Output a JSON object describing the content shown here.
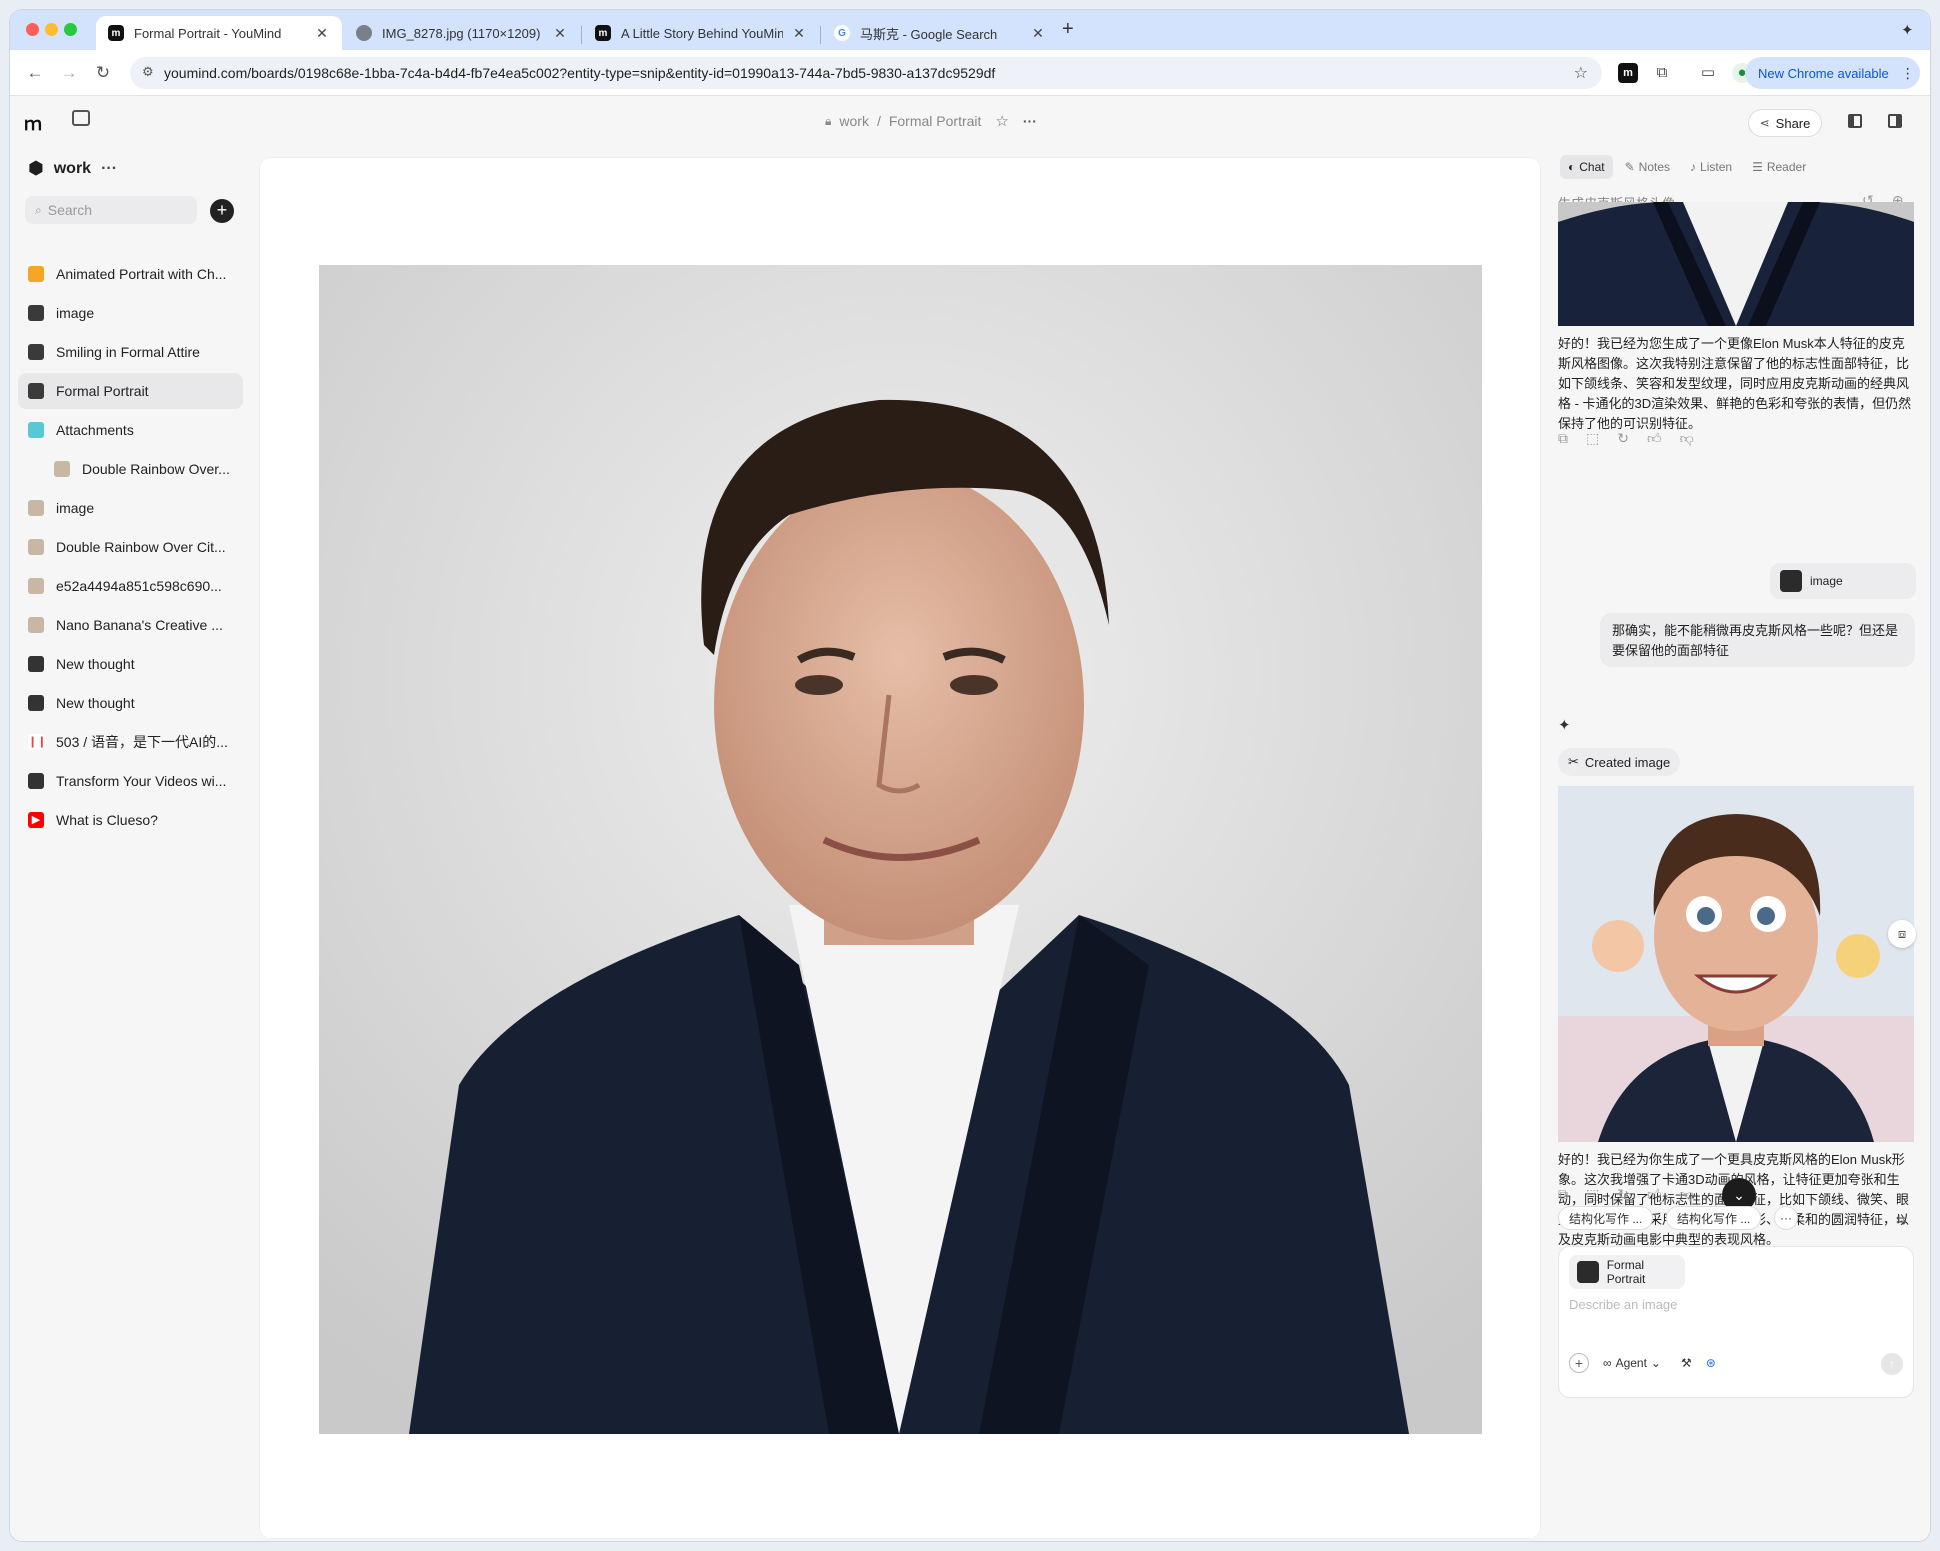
{
  "browser": {
    "tabs": [
      {
        "title": "Formal Portrait - YouMind",
        "active": true
      },
      {
        "title": "IMG_8278.jpg (1170×1209)",
        "active": false
      },
      {
        "title": "A Little Story Behind YouMind",
        "active": false
      },
      {
        "title": "马斯克 - Google Search",
        "active": false
      }
    ],
    "new_tab": "+",
    "url": "youmind.com/boards/0198c68e-1bba-7c4a-b4d4-fb7e4ea5c002?entity-type=snip&entity-id=01990a13-744a-7bd5-9830-a137dc9529df",
    "new_chrome": "New Chrome available"
  },
  "header": {
    "breadcrumb_board": "work",
    "breadcrumb_sep": "/",
    "breadcrumb_page": "Formal Portrait",
    "share": "Share"
  },
  "sidebar": {
    "board_name": "work",
    "board_more": "···",
    "search_placeholder": "Search",
    "items": [
      {
        "label": "Animated Portrait with Ch...",
        "icon": "image-icon"
      },
      {
        "label": "image",
        "icon": "portrait-thumb"
      },
      {
        "label": "Smiling in Formal Attire",
        "icon": "portrait-thumb"
      },
      {
        "label": "Formal Portrait",
        "icon": "portrait-thumb",
        "selected": true
      },
      {
        "label": "Attachments",
        "icon": "folder-icon"
      },
      {
        "label": "Double Rainbow Over...",
        "icon": "image-thumb",
        "indent": true
      },
      {
        "label": "image",
        "icon": "image-thumb"
      },
      {
        "label": "Double Rainbow Over Cit...",
        "icon": "image-thumb"
      },
      {
        "label": "e52a4494a851c598c690...",
        "icon": "image-thumb"
      },
      {
        "label": "Nano Banana's Creative ...",
        "icon": "image-thumb"
      },
      {
        "label": "New thought",
        "icon": "note-icon"
      },
      {
        "label": "New thought",
        "icon": "note-icon"
      },
      {
        "label": "503 / 语音，是下一代AI的...",
        "icon": "audio-icon"
      },
      {
        "label": "Transform Your Videos wi...",
        "icon": "note-icon"
      },
      {
        "label": "What is Clueso?",
        "icon": "youtube-icon"
      }
    ]
  },
  "panel": {
    "tabs": [
      "Chat",
      "Notes",
      "Listen",
      "Reader"
    ],
    "chat_title": "生成皮克斯风格头像",
    "messages": [
      {
        "role": "assistant",
        "text": "好的！我已经为您生成了一个更像Elon Musk本人特征的皮克斯风格图像。这次我特别注意保留了他的标志性面部特征，比如下颌线条、笑容和发型纹理，同时应用皮克斯动画的经典风格 - 卡通化的3D渲染效果、鲜艳的色彩和夸张的表情，但仍然保持了他的可识别特征。"
      },
      {
        "role": "user_image",
        "text": "image"
      },
      {
        "role": "user",
        "text": "那确实，能不能稍微再皮克斯风格一些呢？但还是要保留他的面部特征"
      },
      {
        "role": "tool",
        "text": "Created image"
      },
      {
        "role": "assistant",
        "text": "好的！我已经为你生成了一个更具皮克斯风格的Elon Musk形象。这次我增强了卡通3D动画的风格，让特征更加夸张和生动，同时保留了他标志性的面部特征，比如下颌线、微笑、眼型和发质。图像采用了更明亮的色彩、更柔和的圆润特征，以及皮克斯动画电影中典型的表现风格。"
      }
    ],
    "suggestions": [
      "结构化写作 ...",
      "结构化写作 ..."
    ],
    "composer": {
      "context_chip": "Formal Portrait",
      "placeholder": "Describe an image",
      "mode": "Agent"
    }
  },
  "colors": {
    "tabstrip": "#d3e3fd",
    "sidebar_bg": "#f6f6f7",
    "accent": "#0b57d0"
  }
}
